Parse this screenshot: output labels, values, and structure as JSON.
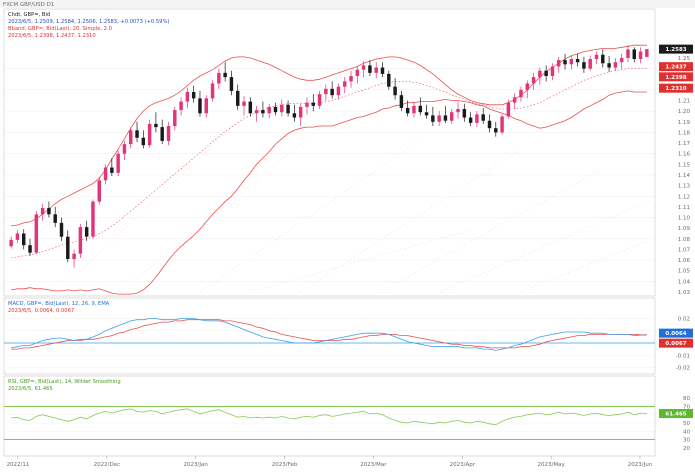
{
  "window": {
    "title": "FXCM GBP/USD D1"
  },
  "legend": {
    "main_line1": "Chdt, GBP=, Bid",
    "main_line2": "2023/6/5, 1.2509, 1.2584, 1.2506, 1.2583, +0.0073 (+0.59%)",
    "main_line3": "Bband, GBP=, Bid(Last), 20, Simple, 2.0",
    "main_line4": "2023/6/5, 1.2398, 1.2437, 1.2310",
    "macd_line1": "MACD, GBP=, Bid(Last), 12, 26, 9, EMA",
    "macd_line2": "2023/6/5, 0.0064, 0.0067",
    "rsi_line1": "RSI, GBP=, Bid(Last), 14, Wilder Smoothing",
    "rsi_line2": "2023/6/5, 61.465"
  },
  "price_axis": {
    "ticks": [
      "1.26",
      "1.25",
      "1.24",
      "1.23",
      "1.22",
      "1.21",
      "1.20",
      "1.19",
      "1.18",
      "1.17",
      "1.16",
      "1.15",
      "1.14",
      "1.13",
      "1.12",
      "1.11",
      "1.10",
      "1.09",
      "1.08",
      "1.07",
      "1.06",
      "1.05",
      "1.04",
      "1.03"
    ],
    "badges": [
      {
        "text": "1.2583",
        "color": "#1a1a1a"
      },
      {
        "text": "1.2437",
        "color": "#e03131"
      },
      {
        "text": "1.2398",
        "color": "#e03131"
      },
      {
        "text": "1.2310",
        "color": "#e03131"
      }
    ]
  },
  "macd_axis": {
    "ticks": [
      "0.02",
      "0.01",
      "0.00",
      "-0.01",
      "-0.02"
    ],
    "badges": [
      {
        "text": "0.0064",
        "color": "#1e6fd9"
      },
      {
        "text": "0.0067",
        "color": "#e03131"
      }
    ]
  },
  "rsi_axis": {
    "ticks": [
      "80",
      "70",
      "60",
      "50",
      "40",
      "30",
      "20"
    ],
    "badges": [
      {
        "text": "61.465",
        "color": "#5cb82e"
      }
    ]
  },
  "date_axis": {
    "labels": [
      "2022/11",
      "2022/Dec",
      "2023/Jan",
      "2023/Feb",
      "2023/Mar",
      "2023/Apr",
      "2023/May",
      "2023/Jun"
    ]
  },
  "colors": {
    "up_candle": "#e0357a",
    "down_candle": "#1a1a1a",
    "bollinger": "#e85050",
    "macd_line": "#3aa0e8",
    "signal_line": "#e85050",
    "zero_line": "#3aa0e8",
    "rsi_line": "#8cc85a",
    "rsi_band": "#6fbf3a",
    "pane_border": "#c8c8c8"
  },
  "chart_data": {
    "type": "candlestick",
    "instrument": "GBP=",
    "interval": "D1",
    "ylim": [
      1.03,
      1.265
    ],
    "candles": [
      [
        1.073,
        1.082,
        1.071,
        1.079
      ],
      [
        1.079,
        1.088,
        1.076,
        1.085
      ],
      [
        1.085,
        1.089,
        1.07,
        1.074
      ],
      [
        1.074,
        1.08,
        1.064,
        1.067
      ],
      [
        1.067,
        1.106,
        1.066,
        1.103
      ],
      [
        1.103,
        1.113,
        1.097,
        1.109
      ],
      [
        1.109,
        1.115,
        1.1,
        1.103
      ],
      [
        1.103,
        1.11,
        1.091,
        1.095
      ],
      [
        1.095,
        1.1,
        1.078,
        1.082
      ],
      [
        1.082,
        1.088,
        1.058,
        1.061
      ],
      [
        1.061,
        1.07,
        1.053,
        1.066
      ],
      [
        1.066,
        1.094,
        1.062,
        1.091
      ],
      [
        1.091,
        1.097,
        1.078,
        1.082
      ],
      [
        1.082,
        1.117,
        1.08,
        1.115
      ],
      [
        1.115,
        1.138,
        1.112,
        1.135
      ],
      [
        1.135,
        1.15,
        1.131,
        1.147
      ],
      [
        1.147,
        1.156,
        1.139,
        1.142
      ],
      [
        1.142,
        1.163,
        1.139,
        1.16
      ],
      [
        1.16,
        1.172,
        1.154,
        1.169
      ],
      [
        1.169,
        1.185,
        1.165,
        1.182
      ],
      [
        1.182,
        1.19,
        1.171,
        1.175
      ],
      [
        1.175,
        1.182,
        1.165,
        1.168
      ],
      [
        1.168,
        1.192,
        1.166,
        1.188
      ],
      [
        1.188,
        1.199,
        1.18,
        1.185
      ],
      [
        1.185,
        1.192,
        1.169,
        1.172
      ],
      [
        1.172,
        1.19,
        1.168,
        1.186
      ],
      [
        1.186,
        1.204,
        1.182,
        1.201
      ],
      [
        1.201,
        1.213,
        1.196,
        1.209
      ],
      [
        1.209,
        1.222,
        1.203,
        1.218
      ],
      [
        1.218,
        1.224,
        1.208,
        1.212
      ],
      [
        1.212,
        1.219,
        1.195,
        1.198
      ],
      [
        1.198,
        1.215,
        1.194,
        1.212
      ],
      [
        1.212,
        1.229,
        1.209,
        1.226
      ],
      [
        1.226,
        1.24,
        1.221,
        1.236
      ],
      [
        1.236,
        1.246,
        1.228,
        1.232
      ],
      [
        1.232,
        1.238,
        1.215,
        1.219
      ],
      [
        1.219,
        1.225,
        1.201,
        1.205
      ],
      [
        1.205,
        1.214,
        1.196,
        1.209
      ],
      [
        1.209,
        1.213,
        1.195,
        1.198
      ],
      [
        1.198,
        1.205,
        1.19,
        1.201
      ],
      [
        1.201,
        1.209,
        1.194,
        1.198
      ],
      [
        1.198,
        1.207,
        1.193,
        1.204
      ],
      [
        1.204,
        1.208,
        1.196,
        1.199
      ],
      [
        1.199,
        1.211,
        1.195,
        1.206
      ],
      [
        1.206,
        1.21,
        1.195,
        1.198
      ],
      [
        1.198,
        1.206,
        1.19,
        1.194
      ],
      [
        1.194,
        1.207,
        1.186,
        1.204
      ],
      [
        1.204,
        1.213,
        1.197,
        1.208
      ],
      [
        1.208,
        1.216,
        1.2,
        1.205
      ],
      [
        1.205,
        1.219,
        1.202,
        1.216
      ],
      [
        1.216,
        1.225,
        1.21,
        1.221
      ],
      [
        1.221,
        1.228,
        1.212,
        1.215
      ],
      [
        1.215,
        1.226,
        1.211,
        1.223
      ],
      [
        1.223,
        1.232,
        1.217,
        1.228
      ],
      [
        1.228,
        1.238,
        1.222,
        1.233
      ],
      [
        1.233,
        1.242,
        1.226,
        1.239
      ],
      [
        1.239,
        1.247,
        1.232,
        1.243
      ],
      [
        1.243,
        1.248,
        1.233,
        1.236
      ],
      [
        1.236,
        1.246,
        1.231,
        1.241
      ],
      [
        1.241,
        1.246,
        1.232,
        1.235
      ],
      [
        1.235,
        1.238,
        1.22,
        1.223
      ],
      [
        1.223,
        1.231,
        1.211,
        1.215
      ],
      [
        1.215,
        1.219,
        1.2,
        1.203
      ],
      [
        1.203,
        1.21,
        1.195,
        1.198
      ],
      [
        1.198,
        1.209,
        1.194,
        1.205
      ],
      [
        1.205,
        1.213,
        1.196,
        1.199
      ],
      [
        1.199,
        1.206,
        1.193,
        1.196
      ],
      [
        1.196,
        1.204,
        1.186,
        1.19
      ],
      [
        1.19,
        1.2,
        1.186,
        1.196
      ],
      [
        1.196,
        1.205,
        1.189,
        1.191
      ],
      [
        1.191,
        1.202,
        1.188,
        1.199
      ],
      [
        1.199,
        1.209,
        1.193,
        1.202
      ],
      [
        1.202,
        1.207,
        1.19,
        1.194
      ],
      [
        1.194,
        1.199,
        1.186,
        1.189
      ],
      [
        1.189,
        1.2,
        1.185,
        1.197
      ],
      [
        1.197,
        1.203,
        1.188,
        1.191
      ],
      [
        1.191,
        1.197,
        1.18,
        1.184
      ],
      [
        1.184,
        1.19,
        1.176,
        1.18
      ],
      [
        1.18,
        1.197,
        1.178,
        1.195
      ],
      [
        1.195,
        1.211,
        1.193,
        1.208
      ],
      [
        1.208,
        1.217,
        1.202,
        1.213
      ],
      [
        1.213,
        1.223,
        1.209,
        1.22
      ],
      [
        1.22,
        1.229,
        1.212,
        1.226
      ],
      [
        1.226,
        1.236,
        1.22,
        1.232
      ],
      [
        1.232,
        1.241,
        1.225,
        1.238
      ],
      [
        1.238,
        1.243,
        1.228,
        1.233
      ],
      [
        1.233,
        1.245,
        1.229,
        1.242
      ],
      [
        1.242,
        1.251,
        1.236,
        1.248
      ],
      [
        1.248,
        1.254,
        1.239,
        1.244
      ],
      [
        1.244,
        1.252,
        1.239,
        1.249
      ],
      [
        1.249,
        1.254,
        1.242,
        1.246
      ],
      [
        1.246,
        1.251,
        1.236,
        1.24
      ],
      [
        1.24,
        1.252,
        1.238,
        1.249
      ],
      [
        1.249,
        1.256,
        1.244,
        1.253
      ],
      [
        1.253,
        1.258,
        1.241,
        1.245
      ],
      [
        1.245,
        1.252,
        1.237,
        1.241
      ],
      [
        1.241,
        1.25,
        1.238,
        1.246
      ],
      [
        1.246,
        1.254,
        1.24,
        1.25
      ],
      [
        1.25,
        1.262,
        1.246,
        1.258
      ],
      [
        1.258,
        1.26,
        1.246,
        1.249
      ],
      [
        1.249,
        1.26,
        1.245,
        1.256
      ],
      [
        1.251,
        1.2584,
        1.2506,
        1.2583
      ]
    ],
    "bollinger": {
      "upper": [
        1.092,
        1.093,
        1.095,
        1.096,
        1.099,
        1.103,
        1.108,
        1.113,
        1.117,
        1.12,
        1.123,
        1.126,
        1.129,
        1.132,
        1.137,
        1.145,
        1.155,
        1.164,
        1.174,
        1.184,
        1.193,
        1.2,
        1.205,
        1.208,
        1.21,
        1.212,
        1.215,
        1.219,
        1.224,
        1.229,
        1.233,
        1.236,
        1.239,
        1.243,
        1.247,
        1.25,
        1.251,
        1.251,
        1.25,
        1.248,
        1.246,
        1.244,
        1.241,
        1.238,
        1.235,
        1.232,
        1.23,
        1.229,
        1.229,
        1.23,
        1.232,
        1.234,
        1.236,
        1.238,
        1.24,
        1.242,
        1.245,
        1.247,
        1.249,
        1.25,
        1.251,
        1.251,
        1.25,
        1.248,
        1.246,
        1.243,
        1.239,
        1.235,
        1.23,
        1.225,
        1.22,
        1.216,
        1.213,
        1.21,
        1.208,
        1.207,
        1.206,
        1.206,
        1.206,
        1.208,
        1.211,
        1.215,
        1.22,
        1.226,
        1.232,
        1.237,
        1.241,
        1.245,
        1.249,
        1.252,
        1.254,
        1.256,
        1.257,
        1.258,
        1.259,
        1.259,
        1.259,
        1.26,
        1.261,
        1.262,
        1.262,
        1.262
      ],
      "middle": [
        1.062,
        1.063,
        1.064,
        1.065,
        1.066,
        1.068,
        1.07,
        1.072,
        1.074,
        1.076,
        1.077,
        1.079,
        1.08,
        1.082,
        1.085,
        1.088,
        1.092,
        1.096,
        1.101,
        1.106,
        1.111,
        1.116,
        1.121,
        1.126,
        1.131,
        1.136,
        1.141,
        1.146,
        1.151,
        1.156,
        1.161,
        1.166,
        1.171,
        1.176,
        1.181,
        1.185,
        1.189,
        1.193,
        1.196,
        1.199,
        1.201,
        1.203,
        1.205,
        1.206,
        1.207,
        1.207,
        1.207,
        1.207,
        1.207,
        1.208,
        1.209,
        1.21,
        1.212,
        1.214,
        1.216,
        1.218,
        1.22,
        1.222,
        1.224,
        1.226,
        1.227,
        1.228,
        1.228,
        1.228,
        1.227,
        1.226,
        1.224,
        1.222,
        1.22,
        1.218,
        1.215,
        1.213,
        1.211,
        1.209,
        1.207,
        1.206,
        1.204,
        1.203,
        1.202,
        1.202,
        1.202,
        1.203,
        1.204,
        1.206,
        1.208,
        1.211,
        1.214,
        1.217,
        1.22,
        1.223,
        1.226,
        1.229,
        1.231,
        1.233,
        1.235,
        1.237,
        1.238,
        1.239,
        1.24,
        1.24,
        1.24,
        1.24
      ],
      "lower": [
        1.032,
        1.033,
        1.033,
        1.034,
        1.033,
        1.033,
        1.032,
        1.031,
        1.031,
        1.032,
        1.031,
        1.032,
        1.031,
        1.032,
        1.033,
        1.031,
        1.029,
        1.028,
        1.028,
        1.028,
        1.029,
        1.032,
        1.037,
        1.044,
        1.052,
        1.06,
        1.067,
        1.073,
        1.078,
        1.083,
        1.089,
        1.096,
        1.103,
        1.109,
        1.115,
        1.12,
        1.127,
        1.135,
        1.142,
        1.15,
        1.156,
        1.162,
        1.169,
        1.174,
        1.179,
        1.182,
        1.184,
        1.185,
        1.185,
        1.186,
        1.186,
        1.186,
        1.188,
        1.19,
        1.192,
        1.194,
        1.195,
        1.197,
        1.199,
        1.202,
        1.203,
        1.205,
        1.206,
        1.208,
        1.208,
        1.209,
        1.209,
        1.209,
        1.21,
        1.211,
        1.21,
        1.21,
        1.209,
        1.208,
        1.206,
        1.205,
        1.202,
        1.2,
        1.198,
        1.196,
        1.193,
        1.191,
        1.188,
        1.186,
        1.184,
        1.185,
        1.187,
        1.189,
        1.191,
        1.194,
        1.198,
        1.202,
        1.205,
        1.208,
        1.211,
        1.215,
        1.217,
        1.218,
        1.219,
        1.218,
        1.218,
        1.218
      ]
    },
    "macd": {
      "ylim": [
        -0.022,
        0.022
      ],
      "macd": [
        -0.004,
        -0.003,
        -0.002,
        -0.002,
        0.0,
        0.002,
        0.003,
        0.004,
        0.004,
        0.003,
        0.002,
        0.003,
        0.003,
        0.005,
        0.007,
        0.01,
        0.012,
        0.014,
        0.016,
        0.018,
        0.019,
        0.019,
        0.02,
        0.02,
        0.019,
        0.019,
        0.019,
        0.02,
        0.02,
        0.02,
        0.019,
        0.018,
        0.018,
        0.018,
        0.017,
        0.015,
        0.013,
        0.011,
        0.009,
        0.007,
        0.005,
        0.004,
        0.003,
        0.002,
        0.001,
        0.0,
        0.0,
        0.0,
        0.0,
        0.001,
        0.002,
        0.003,
        0.004,
        0.005,
        0.006,
        0.007,
        0.008,
        0.008,
        0.008,
        0.008,
        0.007,
        0.005,
        0.003,
        0.001,
        0.0,
        -0.001,
        -0.002,
        -0.003,
        -0.003,
        -0.003,
        -0.003,
        -0.003,
        -0.004,
        -0.004,
        -0.004,
        -0.005,
        -0.005,
        -0.006,
        -0.005,
        -0.004,
        -0.002,
        -0.001,
        0.001,
        0.003,
        0.005,
        0.006,
        0.007,
        0.008,
        0.009,
        0.009,
        0.009,
        0.009,
        0.008,
        0.008,
        0.008,
        0.007,
        0.007,
        0.007,
        0.007,
        0.006,
        0.0064,
        0.0064
      ],
      "signal": [
        -0.005,
        -0.005,
        -0.004,
        -0.004,
        -0.003,
        -0.002,
        -0.001,
        0.0,
        0.001,
        0.002,
        0.002,
        0.002,
        0.003,
        0.003,
        0.004,
        0.005,
        0.006,
        0.008,
        0.009,
        0.011,
        0.012,
        0.014,
        0.015,
        0.016,
        0.017,
        0.017,
        0.018,
        0.018,
        0.019,
        0.019,
        0.019,
        0.019,
        0.019,
        0.019,
        0.018,
        0.018,
        0.017,
        0.016,
        0.015,
        0.013,
        0.012,
        0.01,
        0.009,
        0.007,
        0.006,
        0.005,
        0.004,
        0.003,
        0.002,
        0.002,
        0.002,
        0.002,
        0.002,
        0.003,
        0.003,
        0.004,
        0.005,
        0.006,
        0.006,
        0.007,
        0.007,
        0.007,
        0.006,
        0.006,
        0.005,
        0.004,
        0.003,
        0.002,
        0.001,
        0.0,
        -0.001,
        -0.001,
        -0.002,
        -0.002,
        -0.003,
        -0.003,
        -0.004,
        -0.004,
        -0.004,
        -0.004,
        -0.004,
        -0.003,
        -0.003,
        -0.002,
        -0.001,
        0.001,
        0.002,
        0.003,
        0.004,
        0.005,
        0.006,
        0.006,
        0.007,
        0.007,
        0.007,
        0.007,
        0.007,
        0.007,
        0.007,
        0.007,
        0.0067,
        0.0067
      ]
    },
    "rsi": {
      "ylim": [
        15,
        85
      ],
      "overbought": 70,
      "oversold": 30,
      "values": [
        56,
        57,
        54,
        53,
        58,
        60,
        58,
        56,
        54,
        52,
        54,
        57,
        55,
        59,
        62,
        64,
        62,
        64,
        66,
        67,
        64,
        63,
        65,
        64,
        61,
        63,
        65,
        66,
        67,
        64,
        61,
        63,
        65,
        66,
        63,
        60,
        57,
        58,
        56,
        57,
        56,
        57,
        56,
        58,
        56,
        55,
        57,
        58,
        57,
        59,
        60,
        58,
        59,
        61,
        62,
        63,
        64,
        61,
        62,
        60,
        56,
        53,
        51,
        50,
        52,
        51,
        50,
        49,
        51,
        50,
        52,
        53,
        51,
        50,
        52,
        51,
        49,
        48,
        52,
        55,
        57,
        58,
        60,
        61,
        62,
        60,
        61,
        63,
        61,
        62,
        61,
        59,
        61,
        62,
        60,
        59,
        60,
        61,
        63,
        60,
        62,
        61.465
      ]
    }
  }
}
